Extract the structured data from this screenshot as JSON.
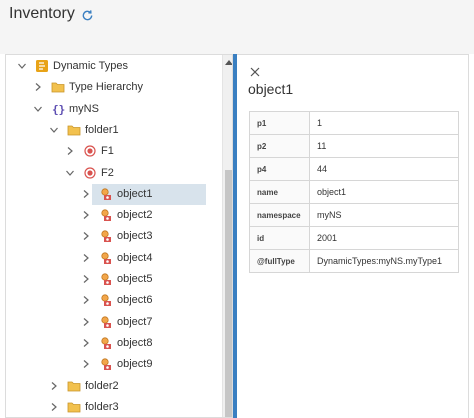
{
  "header": {
    "title": "Inventory",
    "refresh_icon": "refresh-icon"
  },
  "colors": {
    "accent": "#3a7fc1",
    "folder": "#f2c14e",
    "selection": "#d8e3ec",
    "type_brand": "#e8a317",
    "object_red": "#d9534f"
  },
  "tree": [
    {
      "label": "Dynamic Types",
      "icon": "dynamic-types-icon",
      "expander": "down",
      "selected": false
    },
    {
      "label": "Type Hierarchy",
      "icon": "folder-icon",
      "expander": "right",
      "selected": false
    },
    {
      "label": "myNS",
      "icon": "namespace-icon",
      "expander": "down",
      "selected": false
    },
    {
      "label": "folder1",
      "icon": "folder-icon",
      "expander": "down",
      "selected": false
    },
    {
      "label": "F1",
      "icon": "type-icon",
      "expander": "right",
      "selected": false
    },
    {
      "label": "F2",
      "icon": "type-icon",
      "expander": "down",
      "selected": false
    },
    {
      "label": "object1",
      "icon": "object-icon",
      "expander": "right",
      "selected": true
    },
    {
      "label": "object2",
      "icon": "object-icon",
      "expander": "right",
      "selected": false
    },
    {
      "label": "object3",
      "icon": "object-icon",
      "expander": "right",
      "selected": false
    },
    {
      "label": "object4",
      "icon": "object-icon",
      "expander": "right",
      "selected": false
    },
    {
      "label": "object5",
      "icon": "object-icon",
      "expander": "right",
      "selected": false
    },
    {
      "label": "object6",
      "icon": "object-icon",
      "expander": "right",
      "selected": false
    },
    {
      "label": "object7",
      "icon": "object-icon",
      "expander": "right",
      "selected": false
    },
    {
      "label": "object8",
      "icon": "object-icon",
      "expander": "right",
      "selected": false
    },
    {
      "label": "object9",
      "icon": "object-icon",
      "expander": "right",
      "selected": false
    },
    {
      "label": "folder2",
      "icon": "folder-icon",
      "expander": "right",
      "selected": false
    },
    {
      "label": "folder3",
      "icon": "folder-icon",
      "expander": "right",
      "selected": false
    }
  ],
  "detail": {
    "title": "object1",
    "close_icon": "close-icon",
    "properties": [
      {
        "key": "p1",
        "value": "1"
      },
      {
        "key": "p2",
        "value": "11"
      },
      {
        "key": "p4",
        "value": "44"
      },
      {
        "key": "name",
        "value": "object1"
      },
      {
        "key": "namespace",
        "value": "myNS"
      },
      {
        "key": "id",
        "value": "2001"
      },
      {
        "key": "@fullType",
        "value": "DynamicTypes:myNS.myType1"
      }
    ]
  }
}
